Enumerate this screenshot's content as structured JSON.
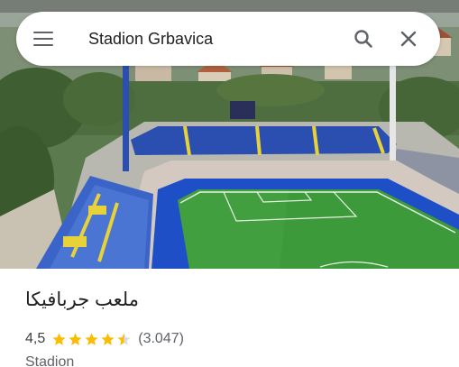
{
  "search": {
    "query": "Stadion Grbavica",
    "menu_icon": "menu-icon",
    "search_icon": "search-icon",
    "close_icon": "close-icon"
  },
  "place": {
    "name": "ملعب جربافيكا",
    "rating": "4,5",
    "rating_value": 4.5,
    "stars_total": 5,
    "review_count": "(3.047)",
    "category": "Stadion"
  },
  "colors": {
    "star": "#fbbc04",
    "icon": "#5f6368",
    "text_primary": "#202124",
    "text_secondary": "#5f6368"
  }
}
